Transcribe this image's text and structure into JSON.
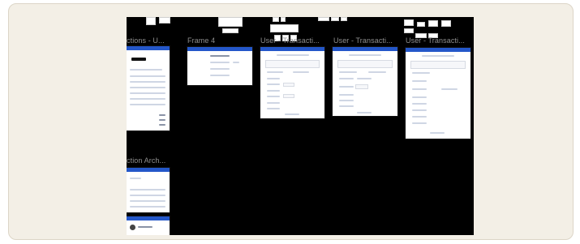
{
  "canvas": {
    "background": "#000000",
    "accent": "#2457c9"
  },
  "frames": [
    {
      "title": "ctions - U..."
    },
    {
      "title": "Frame 4"
    },
    {
      "title": "User - Transacti..."
    },
    {
      "title": "User - Transacti..."
    },
    {
      "title": "User - Transacti..."
    },
    {
      "title": "ction Arch..."
    }
  ]
}
